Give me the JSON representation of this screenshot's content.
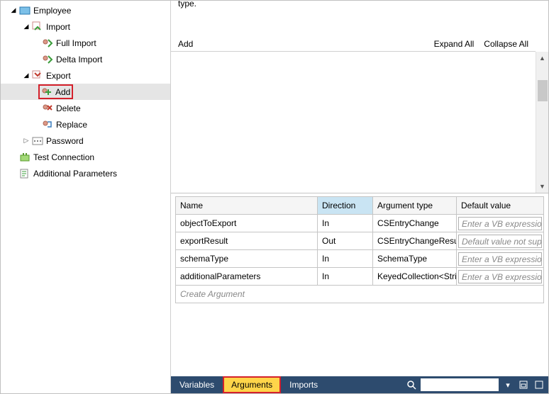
{
  "tree": {
    "root": "Employee",
    "import": "Import",
    "full_import": "Full Import",
    "delta_import": "Delta Import",
    "export": "Export",
    "add": "Add",
    "delete": "Delete",
    "replace": "Replace",
    "password": "Password",
    "test_connection": "Test Connection",
    "additional_parameters": "Additional Parameters"
  },
  "content": {
    "truncated": "type.",
    "add_action": "Add",
    "expand_all": "Expand All",
    "collapse_all": "Collapse All"
  },
  "args": {
    "headers": {
      "name": "Name",
      "direction": "Direction",
      "type": "Argument type",
      "default": "Default value"
    },
    "rows": [
      {
        "name": "objectToExport",
        "direction": "In",
        "type": "CSEntryChange",
        "default": "Enter a VB expression"
      },
      {
        "name": "exportResult",
        "direction": "Out",
        "type": "CSEntryChangeResult",
        "default": "Default value not supported"
      },
      {
        "name": "schemaType",
        "direction": "In",
        "type": "SchemaType",
        "default": "Enter a VB expression"
      },
      {
        "name": "additionalParameters",
        "direction": "In",
        "type": "KeyedCollection<String,ConfigParameter>",
        "default": "Enter a VB expression"
      }
    ],
    "create": "Create Argument"
  },
  "tabs": {
    "variables": "Variables",
    "arguments": "Arguments",
    "imports": "Imports"
  },
  "search": {
    "placeholder": ""
  }
}
